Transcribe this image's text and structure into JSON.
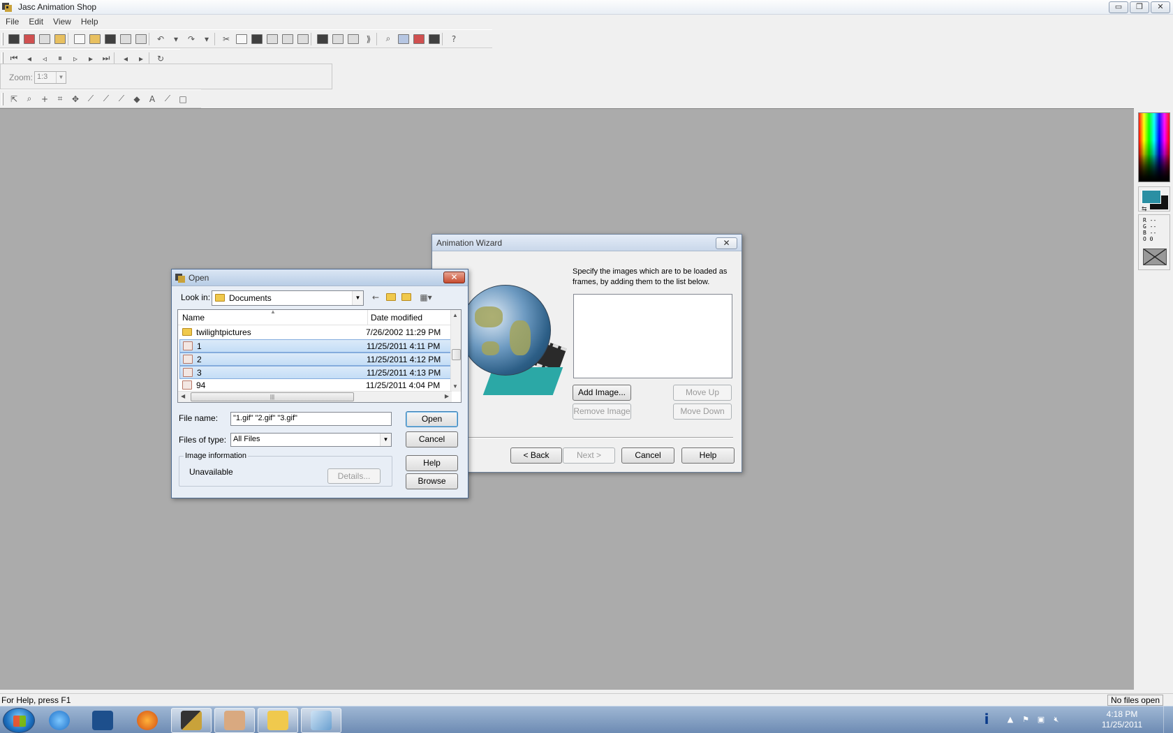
{
  "window": {
    "title": "Jasc Animation Shop",
    "controls": {
      "minimize": "▭",
      "restore": "❐",
      "close": "✕"
    }
  },
  "menu": [
    "File",
    "Edit",
    "View",
    "Help"
  ],
  "zoom": {
    "label": "Zoom:",
    "value": "1:3"
  },
  "color_panel": {
    "foreground": "#2a8fa3",
    "background": "#111111",
    "rgb_readout": [
      "R --",
      "G --",
      "B --",
      "O 0"
    ]
  },
  "status": {
    "help": "For Help, press F1",
    "files": "No files open"
  },
  "wizard": {
    "title": "Animation Wizard",
    "close": "✕",
    "description": "Specify the images which are to be loaded as frames, by adding them to the list below.",
    "buttons": {
      "add": "Add Image...",
      "remove": "Remove Image",
      "move_up": "Move Up",
      "move_down": "Move Down",
      "back": "< Back",
      "next": "Next >",
      "cancel": "Cancel",
      "help": "Help"
    }
  },
  "open_dialog": {
    "title": "Open",
    "close": "✕",
    "look_in_label": "Look in:",
    "look_in_value": "Documents",
    "columns": {
      "name": "Name",
      "date": "Date modified"
    },
    "files": [
      {
        "name": "twilightpictures",
        "date": "7/26/2002 11:29 PM",
        "type": "folder",
        "selected": false
      },
      {
        "name": "1",
        "date": "11/25/2011 4:11 PM",
        "type": "gif",
        "selected": true
      },
      {
        "name": "2",
        "date": "11/25/2011 4:12 PM",
        "type": "gif",
        "selected": true
      },
      {
        "name": "3",
        "date": "11/25/2011 4:13 PM",
        "type": "gif",
        "selected": true
      },
      {
        "name": "94",
        "date": "11/25/2011 4:04 PM",
        "type": "gif",
        "selected": false
      }
    ],
    "file_name_label": "File name:",
    "file_name_value": "\"1.gif\" \"2.gif\" \"3.gif\"",
    "file_type_label": "Files of type:",
    "file_type_value": "All Files",
    "image_info_label": "Image information",
    "image_info_value": "Unavailable",
    "buttons": {
      "open": "Open",
      "cancel": "Cancel",
      "help": "Help",
      "browse": "Browse",
      "details": "Details..."
    }
  },
  "taskbar": {
    "clock_time": "4:18 PM",
    "clock_date": "11/25/2011"
  }
}
